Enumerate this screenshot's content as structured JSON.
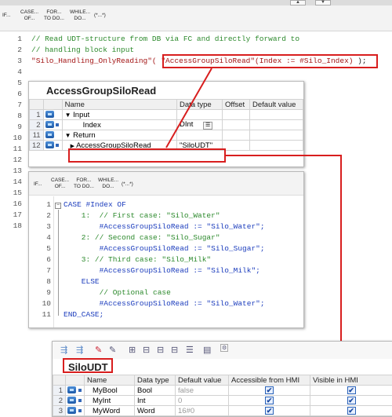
{
  "toolbar": {
    "buttons": [
      {
        "line1": "IF...",
        "line2": ""
      },
      {
        "line1": "CASE...",
        "line2": "OF..."
      },
      {
        "line1": "FOR...",
        "line2": "TO DO..."
      },
      {
        "line1": "WHILE...",
        "line2": "DO..."
      },
      {
        "line1": "(*...*)",
        "line2": ""
      }
    ]
  },
  "editor": {
    "lines": [
      {
        "n": "1",
        "text": "// Read UDT-structure from DB via FC and directly forward to"
      },
      {
        "n": "2",
        "text": "// handling block input"
      },
      {
        "n": "3",
        "pre": "\"Silo_Handling_OnlyReading\"(",
        "call": " \"AccessGroupSiloRead\"(Index := #Silo_Index)",
        "post": " );"
      },
      {
        "n": "4",
        "text": ""
      },
      {
        "n": "5"
      },
      {
        "n": "6"
      },
      {
        "n": "7"
      },
      {
        "n": "8"
      },
      {
        "n": "9"
      },
      {
        "n": "10"
      },
      {
        "n": "11"
      },
      {
        "n": "12"
      },
      {
        "n": "13"
      },
      {
        "n": "14"
      },
      {
        "n": "15"
      },
      {
        "n": "16"
      },
      {
        "n": "17"
      },
      {
        "n": "18"
      }
    ]
  },
  "fc_panel": {
    "title": "AccessGroupSiloRead",
    "headers": [
      "Name",
      "Data type",
      "Offset",
      "Default value"
    ],
    "rows": [
      {
        "num": "1",
        "expand": "▼",
        "name": "Input",
        "type": "",
        "offset": "",
        "default": ""
      },
      {
        "num": "2",
        "expand": "",
        "name": "Index",
        "type": "DInt",
        "offset": "",
        "default": ""
      },
      {
        "num": "11",
        "expand": "▼",
        "name": "Return",
        "type": "",
        "offset": "",
        "default": ""
      },
      {
        "num": "12",
        "expand": "▶",
        "name": "AccessGroupSiloRead",
        "type": "\"SiloUDT\"",
        "offset": "",
        "default": ""
      }
    ]
  },
  "case_panel": {
    "toolbar": [
      {
        "line1": "IF...",
        "line2": ""
      },
      {
        "line1": "CASE...",
        "line2": "OF..."
      },
      {
        "line1": "FOR...",
        "line2": "TO DO..."
      },
      {
        "line1": "WHILE...",
        "line2": "DO..."
      },
      {
        "line1": "(*...*)",
        "line2": ""
      }
    ],
    "lines": [
      {
        "n": "1",
        "text": "CASE #Index OF"
      },
      {
        "n": "2",
        "text": "    1:  // First case: \"Silo_Water\""
      },
      {
        "n": "3",
        "text": "        #AccessGroupSiloRead := \"Silo_Water\";"
      },
      {
        "n": "4",
        "text": "    2: // Second case: \"Silo_Sugar\""
      },
      {
        "n": "5",
        "text": "        #AccessGroupSiloRead := \"Silo_Sugar\";"
      },
      {
        "n": "6",
        "text": "    3: // Third case: \"Silo_Milk\""
      },
      {
        "n": "7",
        "text": "        #AccessGroupSiloRead := \"Silo_Milk\";"
      },
      {
        "n": "8",
        "text": "    ELSE"
      },
      {
        "n": "9",
        "text": "        // Optional case"
      },
      {
        "n": "10",
        "text": "        #AccessGroupSiloRead := \"Silo_Water\";"
      },
      {
        "n": "11",
        "text": "END_CASE;"
      }
    ]
  },
  "udt_panel": {
    "title": "SiloUDT",
    "headers": [
      "Name",
      "Data type",
      "Default value",
      "Accessible from HMI",
      "Visible in HMI"
    ],
    "rows": [
      {
        "num": "1",
        "name": "MyBool",
        "type": "Bool",
        "default": "false",
        "access": "✔",
        "visible": "✔"
      },
      {
        "num": "2",
        "name": "MyInt",
        "type": "Int",
        "default": "0",
        "access": "✔",
        "visible": "✔"
      },
      {
        "num": "3",
        "name": "MyWord",
        "type": "Word",
        "default": "16#0",
        "access": "✔",
        "visible": "✔"
      }
    ]
  },
  "colors": {
    "highlight": "#d81e1e",
    "accent": "#1c3dbd"
  }
}
